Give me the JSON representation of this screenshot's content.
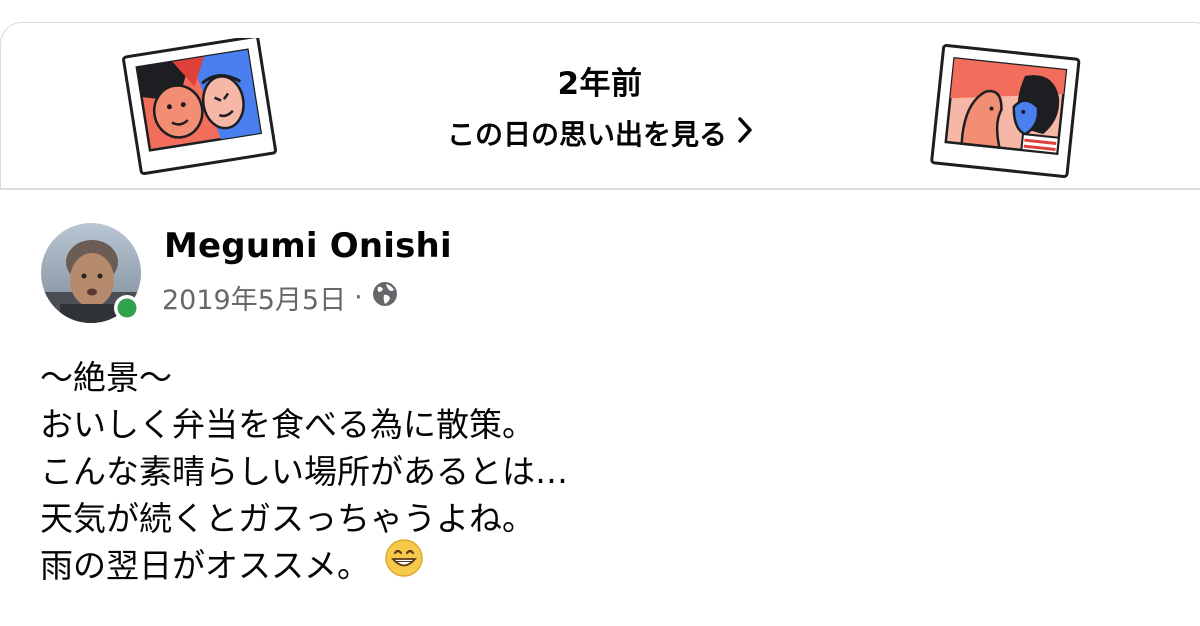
{
  "memory": {
    "heading": "2年前",
    "link_label": "この日の思い出を見る"
  },
  "post": {
    "author": "Megumi Onishi",
    "date": "2019年5月5日",
    "separator": "·",
    "privacy_icon": "globe-icon",
    "lines": [
      "～絶景～",
      "おいしく弁当を食べる為に散策。",
      "こんな素晴らしい場所があるとは…",
      "天気が続くとガスっちゃうよね。",
      "雨の翌日がオススメ。"
    ],
    "emoji": "grinning-face-emoji",
    "online_status": "active"
  },
  "colors": {
    "online": "#31a24c",
    "meta_text": "#65676b",
    "border": "#dadde1",
    "illustration_coral": "#f26d5b",
    "illustration_blue": "#4a7ff0",
    "illustration_red": "#e0403a"
  }
}
